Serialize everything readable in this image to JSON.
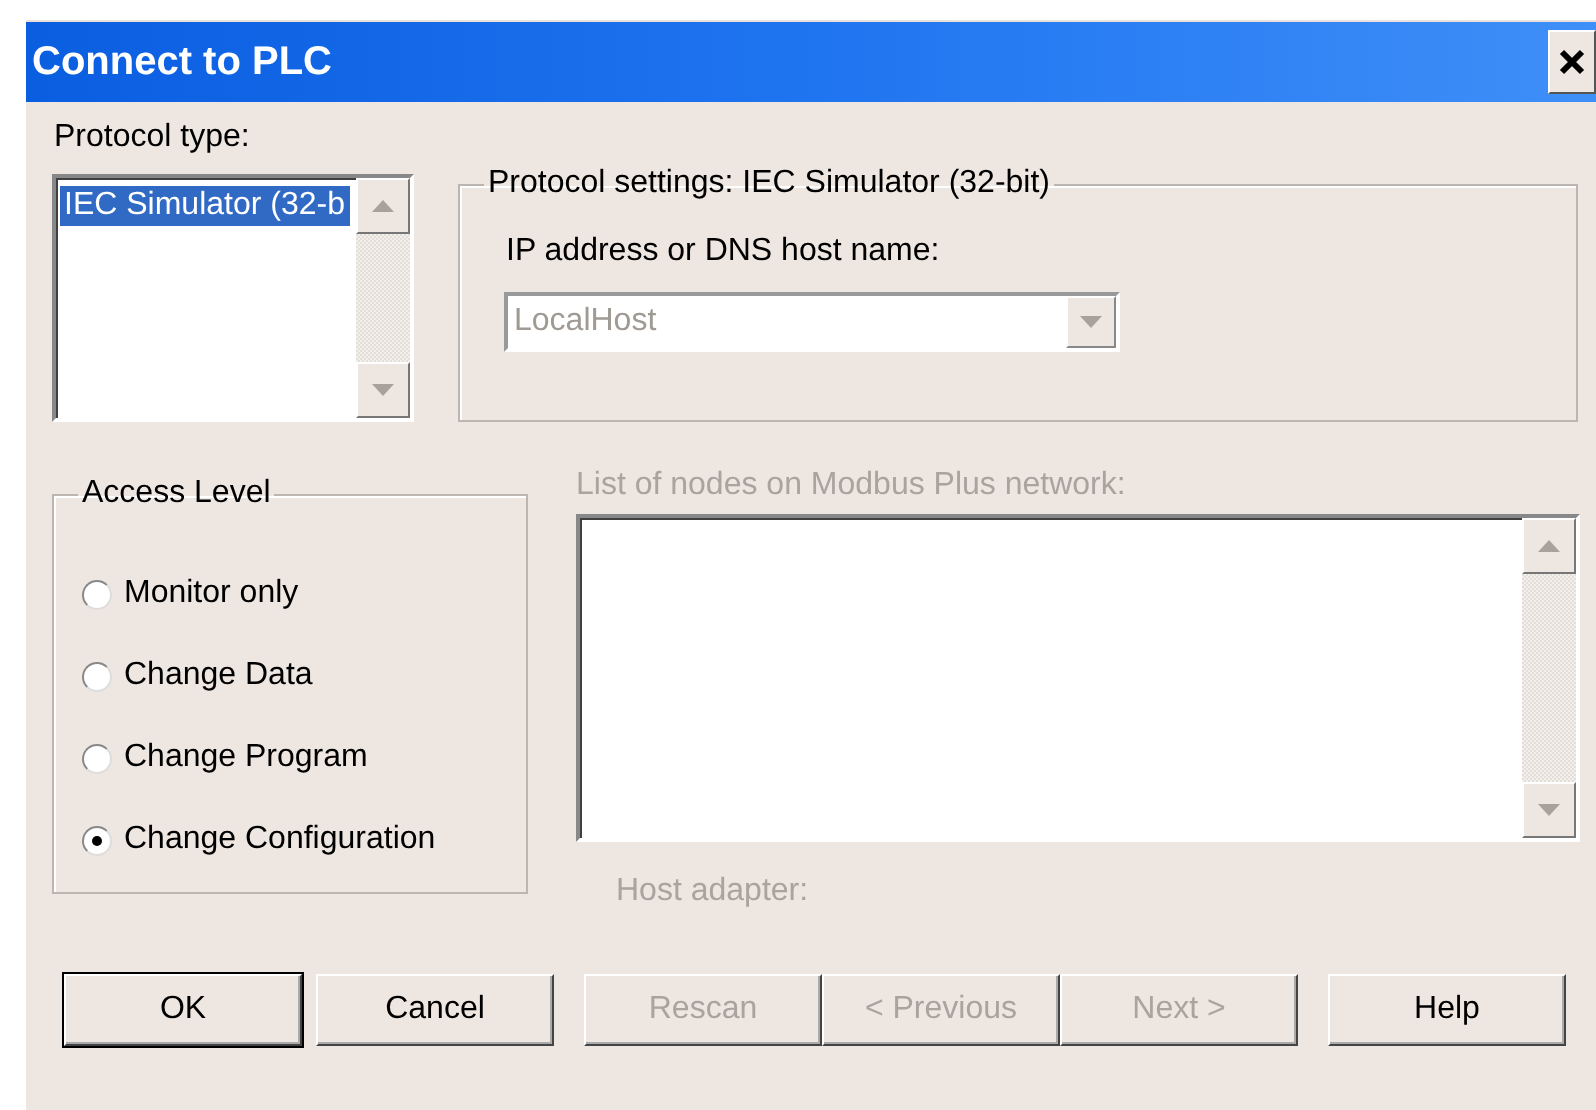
{
  "window": {
    "title": "Connect to PLC"
  },
  "protocol_type": {
    "label": "Protocol type:",
    "items": [
      {
        "text": "IEC Simulator (32-b",
        "selected": true
      }
    ]
  },
  "protocol_settings": {
    "title": "Protocol settings: IEC Simulator (32-bit)",
    "field_label": "IP address or DNS host name:",
    "host": {
      "value": "LocalHost",
      "disabled": true
    }
  },
  "access_level": {
    "title": "Access Level",
    "options": [
      {
        "label": "Monitor only",
        "selected": false
      },
      {
        "label": "Change Data",
        "selected": false
      },
      {
        "label": "Change Program",
        "selected": false
      },
      {
        "label": "Change Configuration",
        "selected": true
      }
    ]
  },
  "nodes": {
    "label": "List of nodes on Modbus Plus network:",
    "disabled": true
  },
  "host_adapter": {
    "label": "Host adapter:",
    "disabled": true
  },
  "buttons": [
    {
      "label": "OK",
      "default": true,
      "disabled": false
    },
    {
      "label": "Cancel",
      "default": false,
      "disabled": false
    },
    {
      "label": "Rescan",
      "default": false,
      "disabled": true
    },
    {
      "label": "< Previous",
      "default": false,
      "disabled": true
    },
    {
      "label": "Next >",
      "default": false,
      "disabled": true
    },
    {
      "label": "Help",
      "default": false,
      "disabled": false
    }
  ]
}
